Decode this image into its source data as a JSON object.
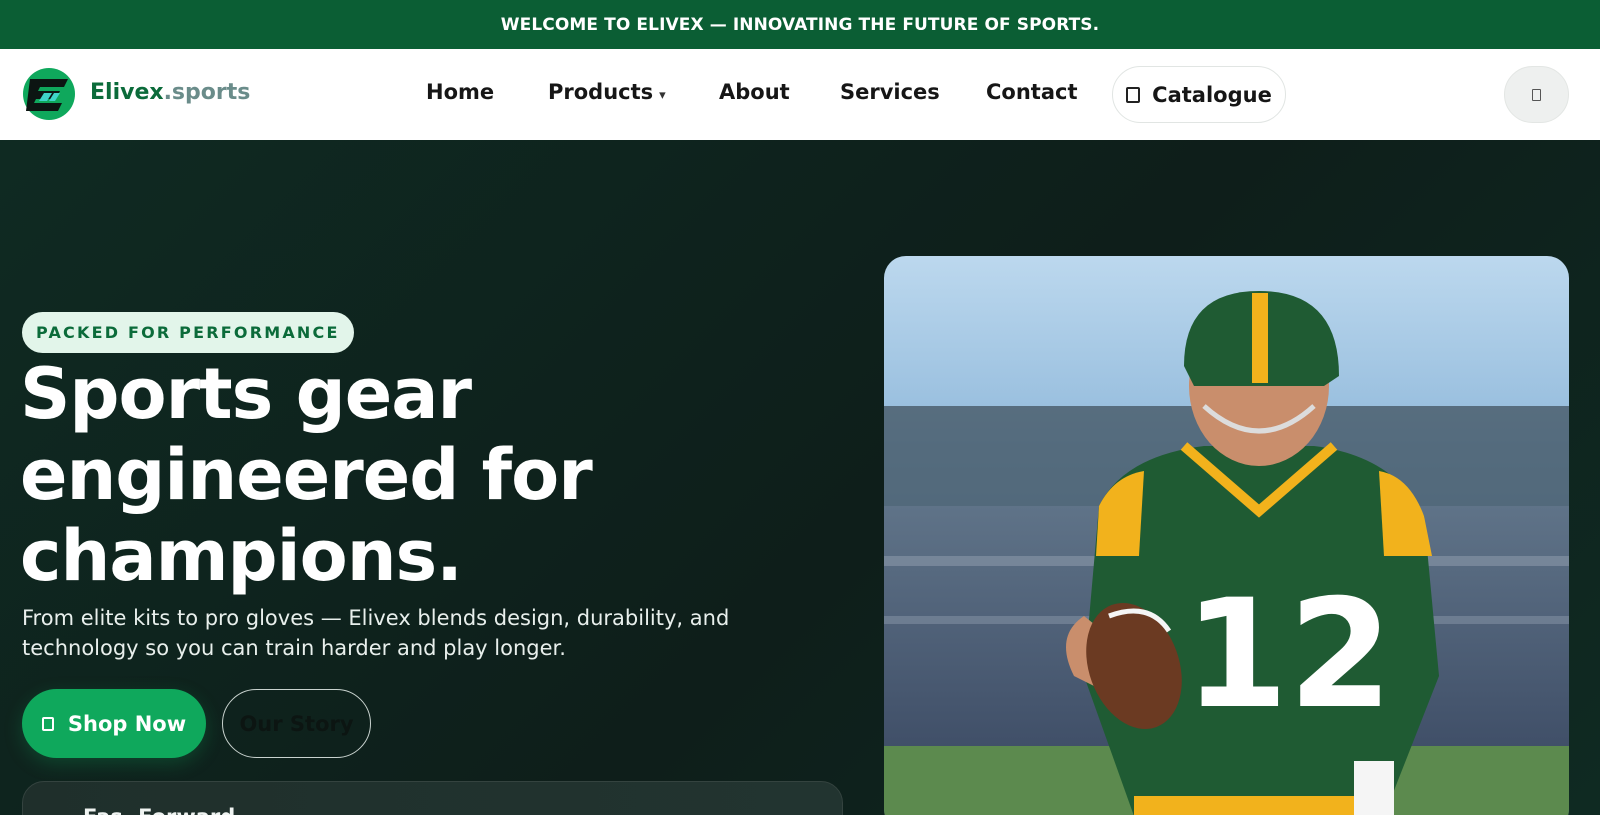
{
  "topbar": {
    "prefix": "WELCOME TO",
    "brand": "ELIVEX",
    "suffix": "— INNOVATING THE FUTURE OF SPORTS."
  },
  "brand": {
    "part1": "Elivex",
    "part2": ".sports"
  },
  "nav": {
    "items": [
      {
        "label": "Home"
      },
      {
        "label": "Products"
      },
      {
        "label": "About"
      },
      {
        "label": "Services"
      },
      {
        "label": "Contact"
      }
    ],
    "catalogue_label": "Catalogue"
  },
  "hero": {
    "badge": "PACKED FOR PERFORMANCE",
    "headline_line1": "Sports gear",
    "headline_line2": "engineered for",
    "headline_line3": "champions.",
    "subtext": "From elite kits to pro gloves — Elivex blends design, durability, and technology so you can train harder and play longer.",
    "shop_label": "Shop Now",
    "story_label": "Our Story",
    "card_title": "Fas. Forward"
  },
  "colors": {
    "topbar": "#0b5e34",
    "accent": "#0fa85c",
    "brand_dark": "#0b6b3a",
    "hero_bg": "#0f1f1a"
  },
  "icons": {
    "products_caret": "chevron-down-icon",
    "catalogue": "book-icon",
    "cart": "bag-icon",
    "shop": "cart-icon"
  }
}
